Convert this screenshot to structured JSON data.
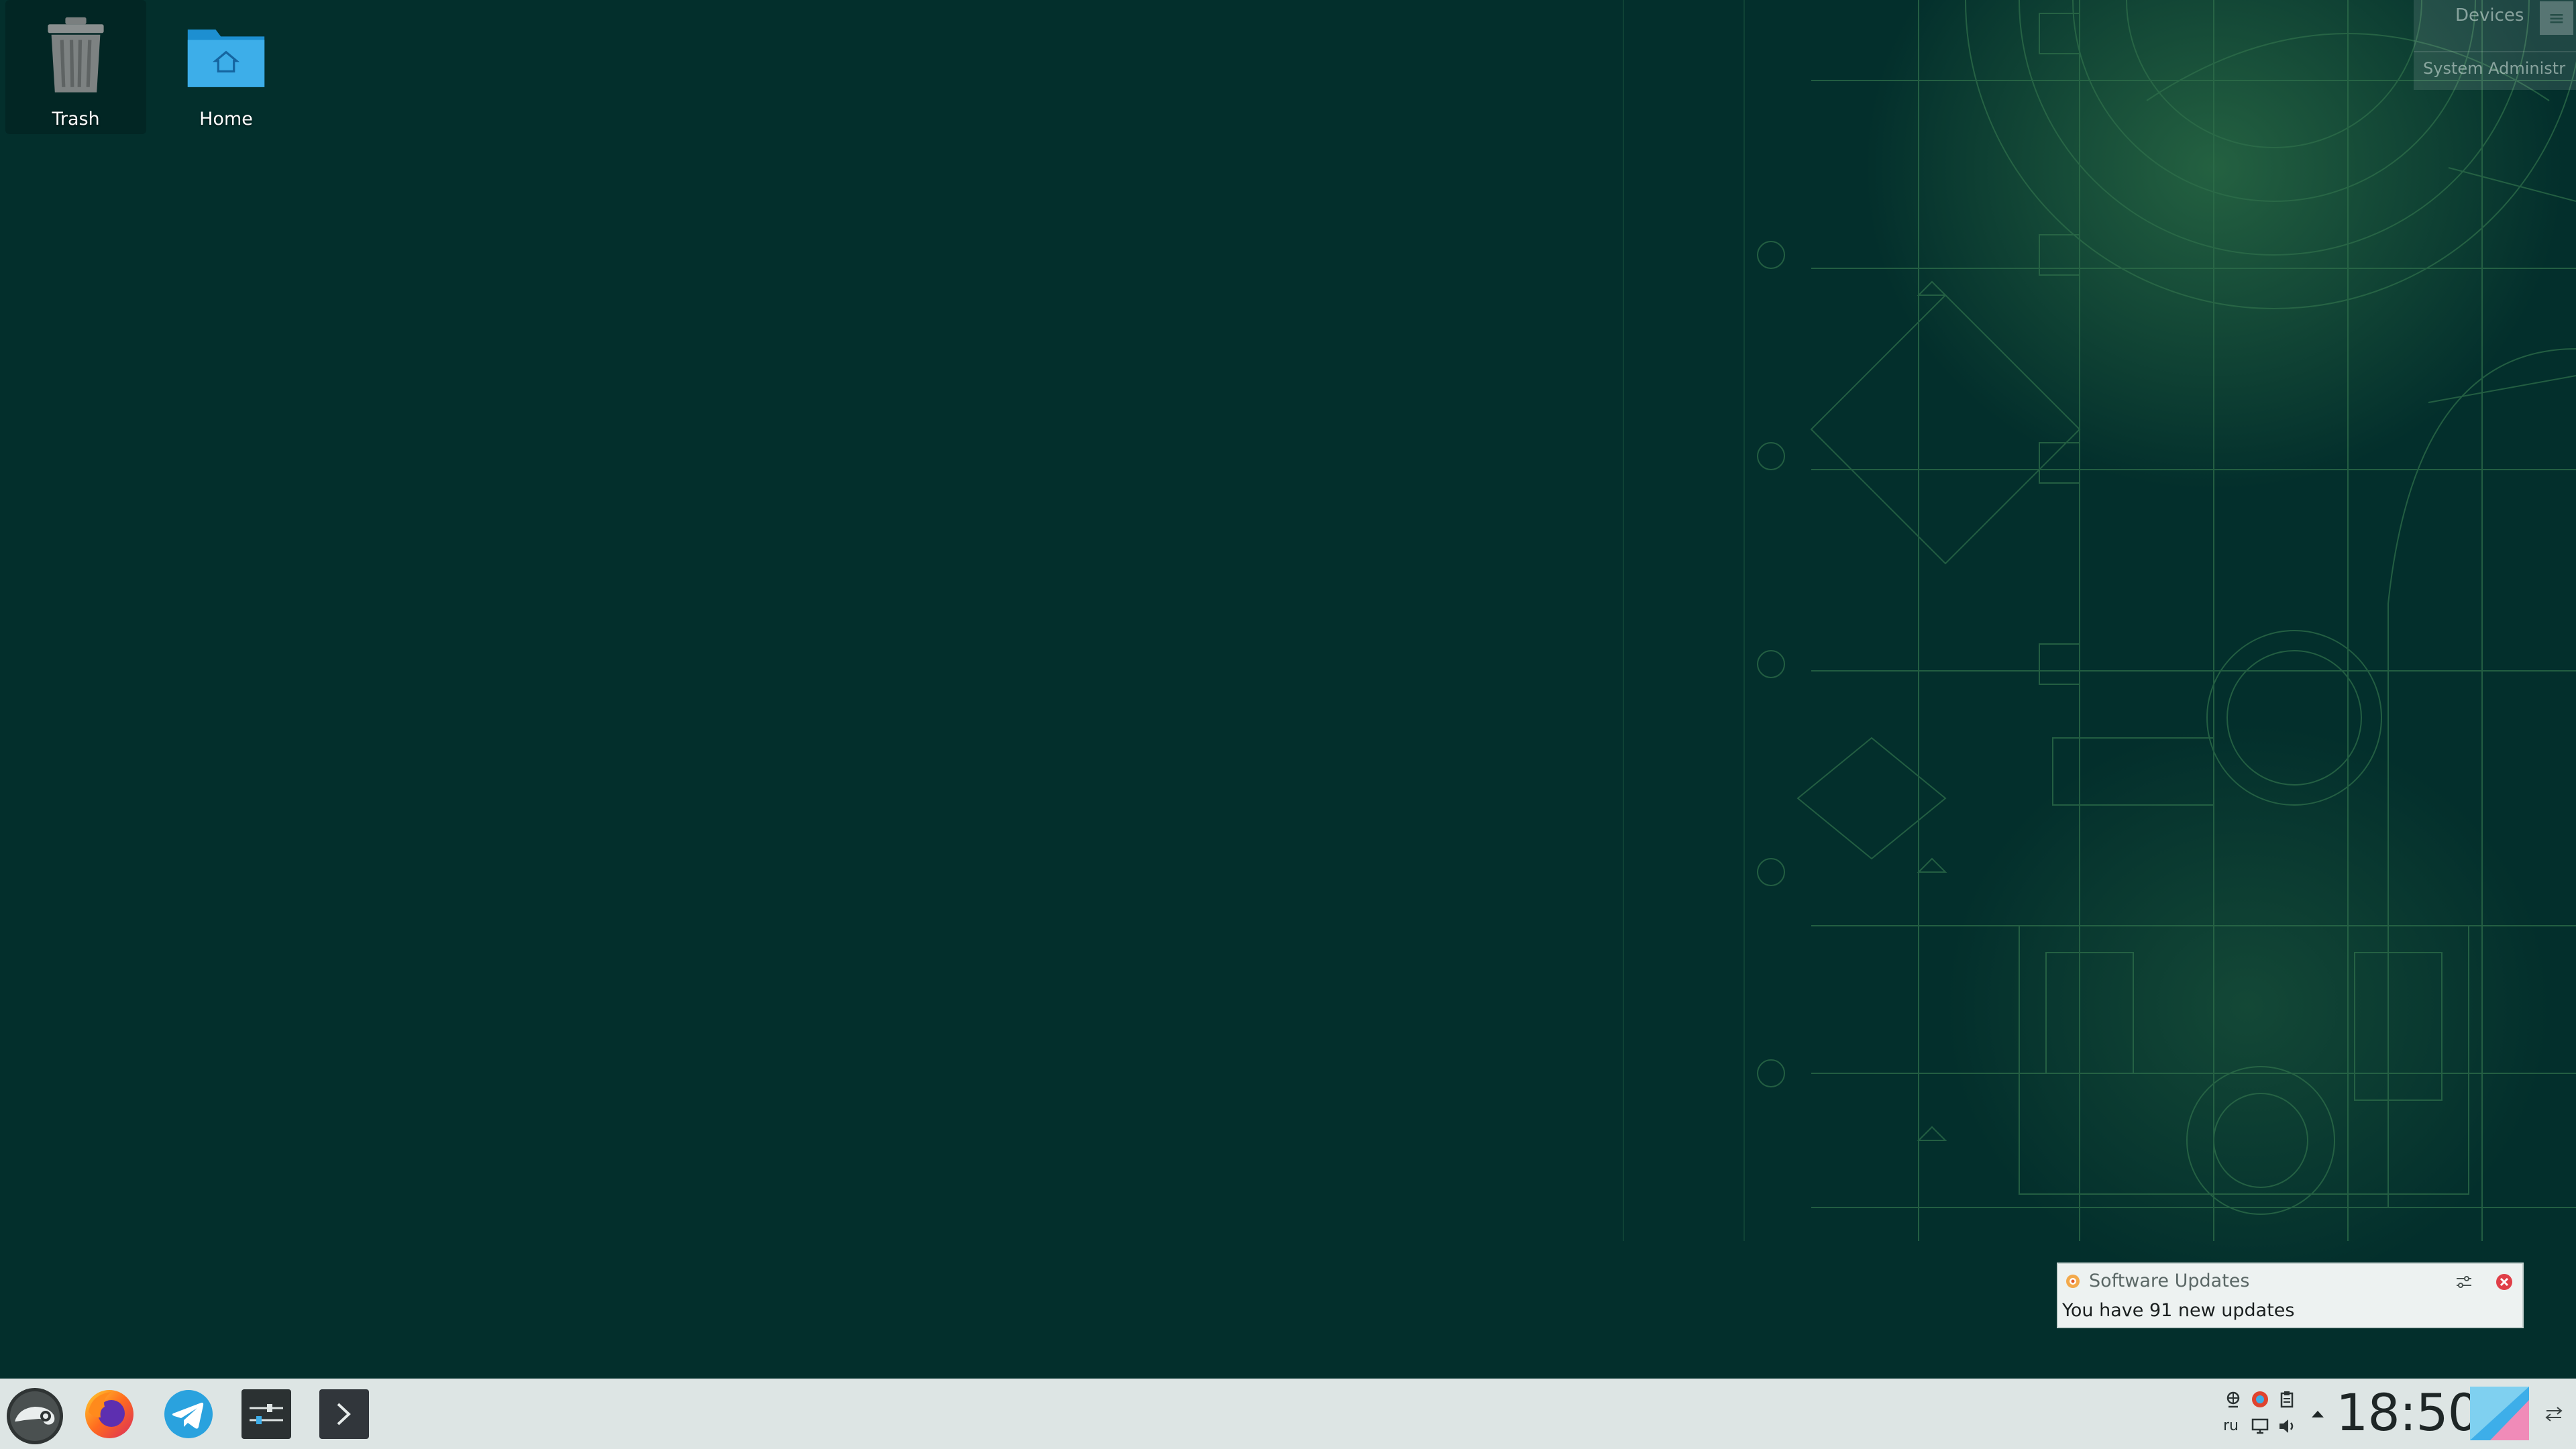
{
  "desktop": {
    "background_color": "#032f2c",
    "pattern_color": "#2f7a4e",
    "icons": [
      {
        "label": "Trash",
        "icon": "trash-icon"
      },
      {
        "label": "Home",
        "icon": "home-folder-icon"
      }
    ]
  },
  "folder_view": {
    "title": "Devices",
    "row": "System Administr"
  },
  "notification": {
    "app_name": "Software Updates",
    "body": "You have 91 new updates",
    "icons": [
      "software-update-icon",
      "configure-icon",
      "close-icon"
    ]
  },
  "taskbar": {
    "launchers": [
      {
        "name": "Application Menu",
        "icon": "opensuse-gecko-icon"
      },
      {
        "name": "Firefox",
        "icon": "firefox-icon"
      },
      {
        "name": "Telegram",
        "icon": "telegram-icon"
      },
      {
        "name": "System Settings",
        "icon": "settings-sliders-icon"
      },
      {
        "name": "Konsole",
        "icon": "terminal-icon"
      }
    ],
    "tray": {
      "keyboard_layout": "ru",
      "icons": [
        "network-icon",
        "update-notifier-icon",
        "clipboard-icon",
        "display-icon",
        "volume-icon",
        "expand-arrow-icon"
      ]
    },
    "clock": "18:50",
    "accent_color": "#73ba25"
  }
}
